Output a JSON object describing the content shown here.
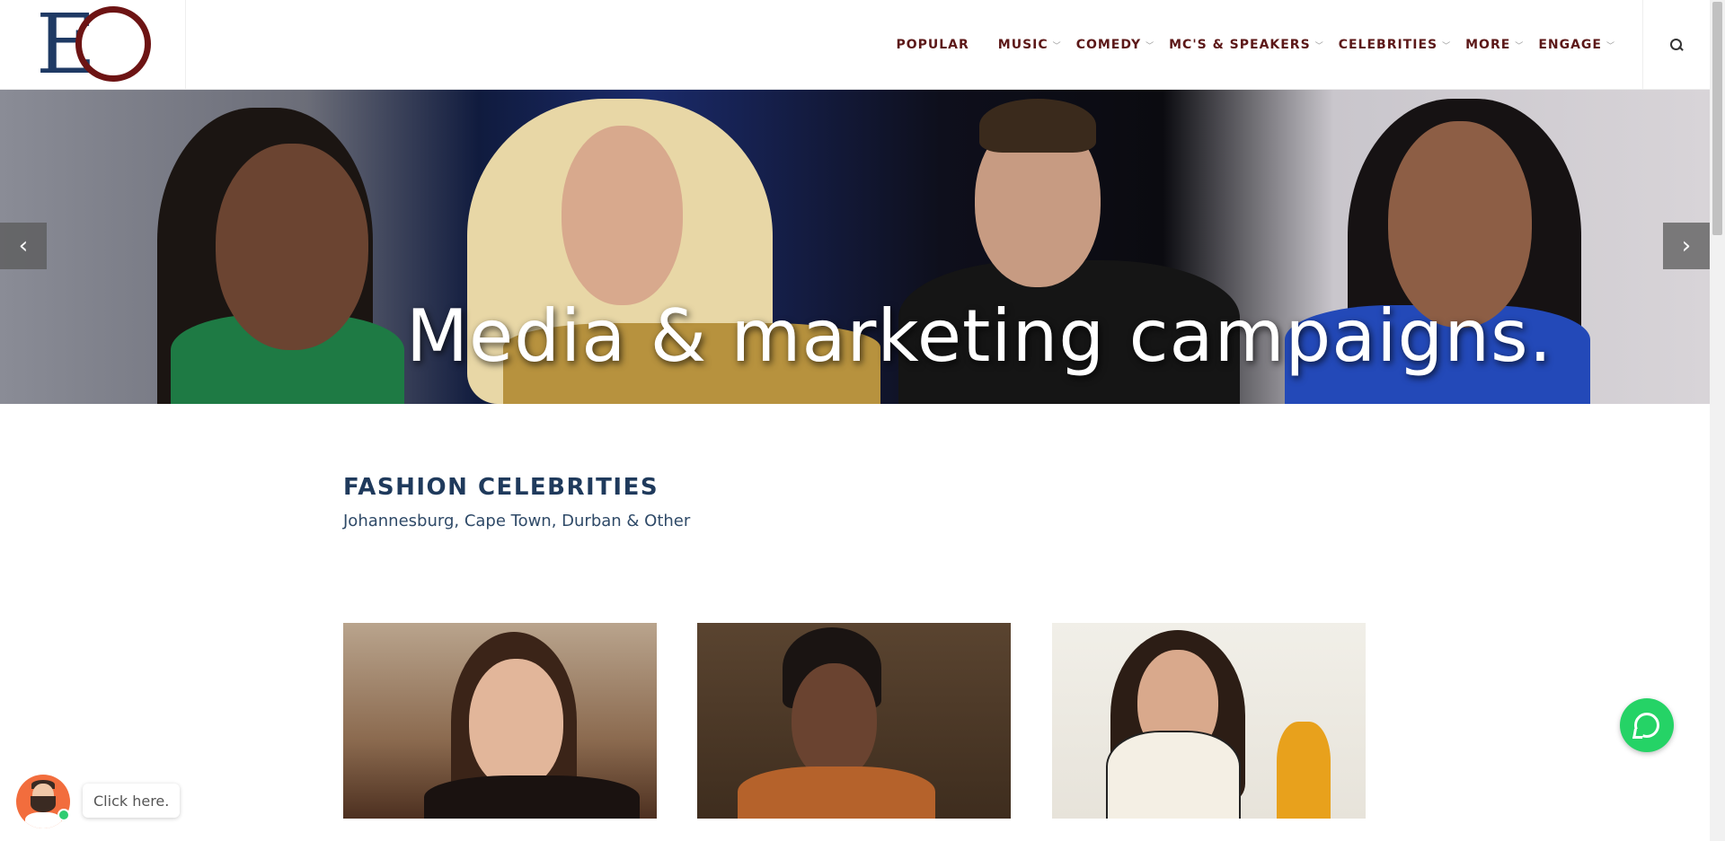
{
  "header": {
    "logo_letters": "EO",
    "nav": [
      {
        "label": "POPULAR",
        "dropdown": false
      },
      {
        "label": "MUSIC",
        "dropdown": true
      },
      {
        "label": "COMEDY",
        "dropdown": true
      },
      {
        "label": "MC'S & SPEAKERS",
        "dropdown": true
      },
      {
        "label": "CELEBRITIES",
        "dropdown": true
      },
      {
        "label": "MORE",
        "dropdown": true
      },
      {
        "label": "ENGAGE",
        "dropdown": true
      }
    ],
    "search_icon": "search-icon"
  },
  "hero": {
    "caption": "Media & marketing campaigns.",
    "prev_icon": "chevron-left-icon",
    "next_icon": "chevron-right-icon",
    "prev_glyph": "‹",
    "next_glyph": "›"
  },
  "section": {
    "title": "FASHION CELEBRITIES",
    "subtitle": "Johannesburg, Cape Town, Durban & Other"
  },
  "chat": {
    "label": "Click here."
  },
  "colors": {
    "brand_blue": "#1f3a64",
    "brand_maroon": "#6d1414",
    "nav_text": "#5c1818",
    "whatsapp_green": "#25d366",
    "chat_orange": "#f26d3d"
  }
}
